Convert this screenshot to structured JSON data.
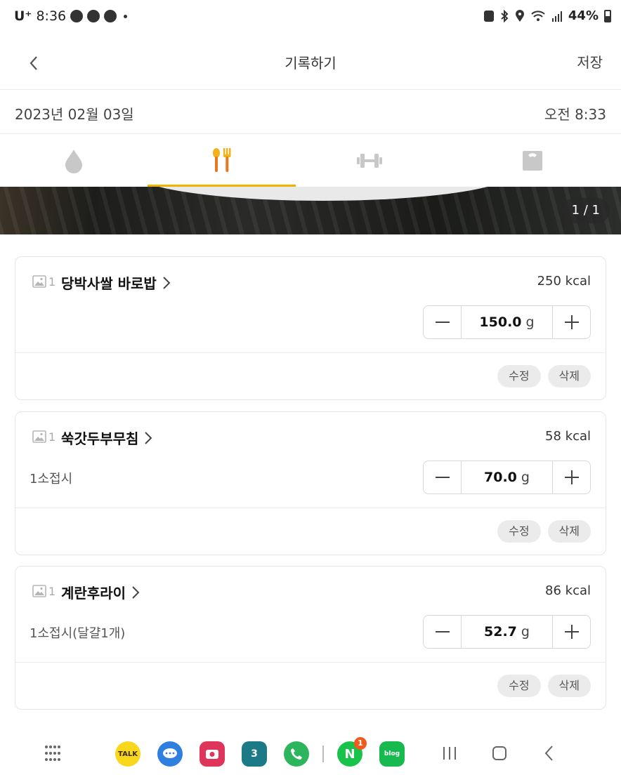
{
  "status_bar": {
    "carrier": "U⁺",
    "time": "8:36",
    "battery": "44%"
  },
  "header": {
    "title": "기록하기",
    "save_label": "저장"
  },
  "date_row": {
    "date": "2023년 02월 03일",
    "time": "오전 8:33"
  },
  "tabs": [
    {
      "icon": "water-drop-icon",
      "active": false
    },
    {
      "icon": "fork-spoon-icon",
      "active": true
    },
    {
      "icon": "dumbbell-icon",
      "active": false
    },
    {
      "icon": "scale-icon",
      "active": false
    }
  ],
  "photo": {
    "page_indicator": "1 / 1"
  },
  "foods": [
    {
      "image_count": "1",
      "name": "당박사쌀 바로밥",
      "kcal": "250 kcal",
      "portion": "",
      "amount": "150.0",
      "unit": "g",
      "edit_label": "수정",
      "delete_label": "삭제"
    },
    {
      "image_count": "1",
      "name": "쑥갓두부무침",
      "kcal": "58 kcal",
      "portion": "1소접시",
      "amount": "70.0",
      "unit": "g",
      "edit_label": "수정",
      "delete_label": "삭제"
    },
    {
      "image_count": "1",
      "name": "계란후라이",
      "kcal": "86 kcal",
      "portion": "1소접시(달걀1개)",
      "amount": "52.7",
      "unit": "g",
      "edit_label": "수정",
      "delete_label": "삭제"
    }
  ],
  "bottom_apps": [
    {
      "name": "kakaotalk",
      "label": "TALK",
      "color": "#f9d71c"
    },
    {
      "name": "messages",
      "label": "",
      "color": "#2f7fe0"
    },
    {
      "name": "camera",
      "label": "",
      "color": "#e0355a"
    },
    {
      "name": "calendar",
      "label": "3",
      "color": "#1b7a86"
    },
    {
      "name": "phone",
      "label": "",
      "color": "#2db55d"
    },
    {
      "name": "naver",
      "label": "N",
      "color": "#19c24a",
      "badge": "1"
    },
    {
      "name": "blog",
      "label": "blog",
      "color": "#18b94e"
    }
  ]
}
